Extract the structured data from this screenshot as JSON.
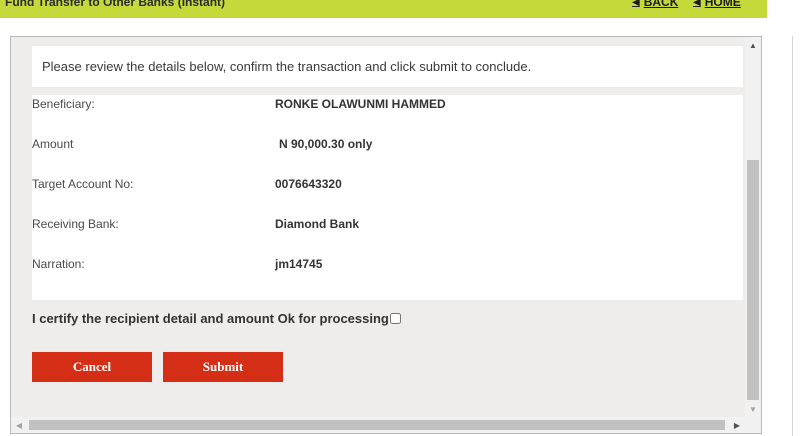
{
  "header": {
    "title": "Fund Transfer to Other Banks (Instant)",
    "back_label": "BACK",
    "home_label": "HOME",
    "accent_color": "#c5d93a"
  },
  "notice": "Please review the details below, confirm the transaction and click submit to conclude.",
  "details": [
    {
      "label": "Beneficiary:",
      "value": "RONKE OLAWUNMI HAMMED"
    },
    {
      "label": "Amount",
      "value": "N 90,000.30 only"
    },
    {
      "label": "Target Account No:",
      "value": "0076643320"
    },
    {
      "label": "Receiving Bank:",
      "value": "Diamond Bank"
    },
    {
      "label": "Narration:",
      "value": "jm14745"
    }
  ],
  "certify_label": "I certify the recipient detail and amount Ok for processing",
  "buttons": {
    "cancel_label": "Cancel",
    "submit_label": "Submit",
    "color": "#d52e17"
  },
  "icons": {
    "back": "arrow-left-icon",
    "home": "arrow-left-icon",
    "scroll_up": "triangle-up-icon",
    "scroll_down": "triangle-down-icon",
    "scroll_left": "triangle-left-icon",
    "scroll_right": "triangle-right-icon"
  }
}
